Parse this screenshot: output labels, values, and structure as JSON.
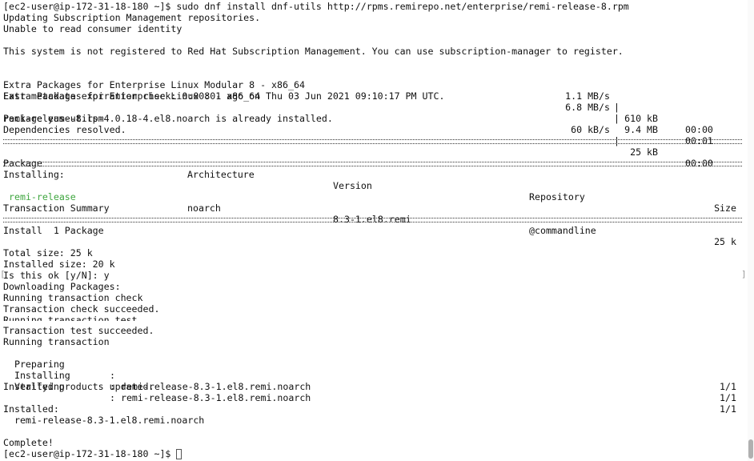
{
  "prompt": "[ec2-user@ip-172-31-18-180 ~]$ ",
  "command": "sudo dnf install dnf-utils http://rpms.remirepo.net/enterprise/remi-release-8.rpm",
  "msg_updating": "Updating Subscription Management repositories.",
  "msg_unable": "Unable to read consumer identity",
  "msg_not_registered": "This system is not registered to Red Hat Subscription Management. You can use subscription-manager to register.",
  "repos": [
    {
      "name": "Extra Packages for Enterprise Linux Modular 8 - x86_64",
      "speed": "1.1 MB/s",
      "size": "610 kB",
      "time": "00:00"
    },
    {
      "name": "Extra Packages for Enterprise Linux 8 - x86_64",
      "speed": "6.8 MB/s",
      "size": "9.4 MB",
      "time": "00:01"
    }
  ],
  "metadata_check": "Last metadata expiration check: 0:00:01 ago on Thu 03 Jun 2021 09:10:17 PM UTC.",
  "rpm_download": {
    "name": "remi-release-8.rpm",
    "speed": "60 kB/s",
    "size": "25 kB",
    "time": "00:00"
  },
  "already_installed": "Package yum-utils-4.0.18-4.el8.noarch is already installed.",
  "deps_resolved": "Dependencies resolved.",
  "table_headers": {
    "package": "Package",
    "architecture": "Architecture",
    "version": "Version",
    "repository": "Repository",
    "size": "Size"
  },
  "installing_label": "Installing:",
  "package_row": {
    "package": "remi-release",
    "architecture": "noarch",
    "version": "8.3-1.el8.remi",
    "repository": "@commandline",
    "size": "25 k"
  },
  "transaction_summary": "Transaction Summary",
  "install_count": "Install  1 Package",
  "total_size": "Total size: 25 k",
  "installed_size": "Installed size: 20 k",
  "confirm_prompt": "Is this ok [y/N]: y",
  "downloading": "Downloading Packages:",
  "running_check": "Running transaction check",
  "check_succeeded": "Transaction check succeeded.",
  "running_test": "Running transaction test",
  "test_succeeded": "Transaction test succeeded.",
  "running_transaction": "Running transaction",
  "steps": [
    {
      "label": "  Preparing",
      "detail": ":",
      "progress": "1/1"
    },
    {
      "label": "  Installing",
      "detail": ": remi-release-8.3-1.el8.remi.noarch",
      "progress": "1/1"
    },
    {
      "label": "  Verifying",
      "detail": ": remi-release-8.3-1.el8.remi.noarch",
      "progress": "1/1"
    }
  ],
  "products_updated": "Installed products updated.",
  "installed_label": "Installed:",
  "installed_pkg": "  remi-release-8.3-1.el8.remi.noarch",
  "complete": "Complete!",
  "final_prompt": "[ec2-user@ip-172-31-18-180 ~]$ "
}
